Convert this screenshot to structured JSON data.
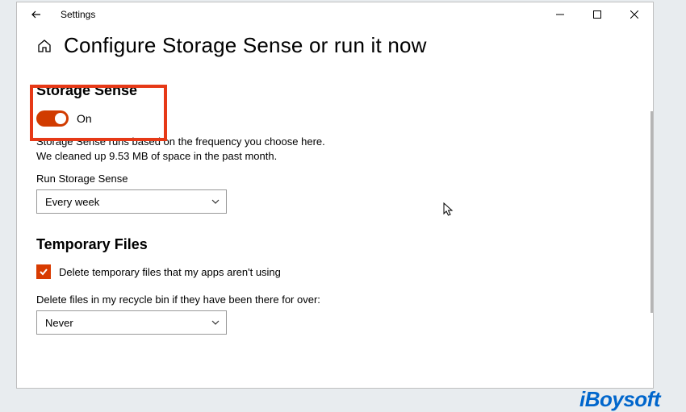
{
  "window": {
    "app_name": "Settings"
  },
  "page": {
    "title": "Configure Storage Sense or run it now"
  },
  "storage_sense": {
    "heading": "Storage Sense",
    "toggle_state": "On",
    "description": "Storage Sense runs based on the frequency you choose here. We cleaned up 9.53 MB of space in the past month.",
    "run_label": "Run Storage Sense",
    "run_value": "Every week"
  },
  "temp_files": {
    "heading": "Temporary Files",
    "delete_unused_label": "Delete temporary files that my apps aren't using",
    "delete_unused_checked": true,
    "recycle_label": "Delete files in my recycle bin if they have been there for over:",
    "recycle_value": "Never"
  },
  "watermark": "iBoysoft",
  "colors": {
    "accent": "#d83b01",
    "highlight": "#e63917",
    "brand": "#0066cc"
  }
}
